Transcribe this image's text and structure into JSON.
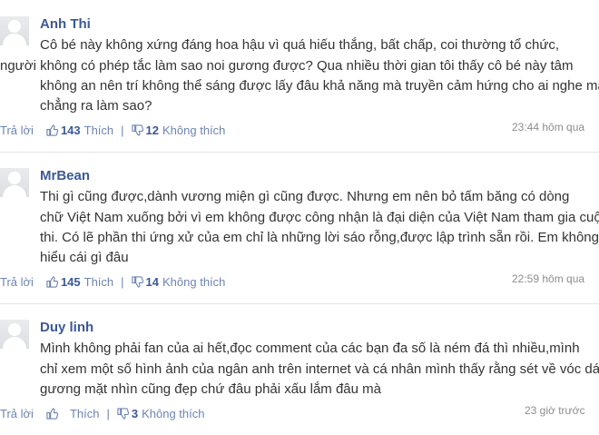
{
  "comments": [
    {
      "author": "Anh Thi",
      "lines": [
        "Cô bé này không xứng đáng hoa hậu vì quá hiếu thắng, bất chấp, coi thường tổ chức,",
        "người không có phép tắc làm sao noi gương được? Qua nhiều thời gian tôi thấy cô bé này tâm",
        "không an nên trí không thể sáng được lấy đâu khả năng mà truyền cảm hứng cho ai nghe mà",
        "chẳng ra làm sao?"
      ],
      "reply_label": "Trả lời",
      "like_count": "143",
      "like_label": "Thích",
      "dislike_count": "12",
      "dislike_label": "Không thích",
      "time": "23:44 hôm qua"
    },
    {
      "author": "MrBean",
      "lines": [
        "Thi gì cũng được,dành vương miện gì cũng được. Nhưng em nên bỏ tấm băng có dòng",
        "chữ Việt Nam xuống bởi vì em không được công nhận là đại diện của Việt Nam tham gia cuộc",
        "thi. Có lẽ phần thi ứng xử của em chỉ là những lời sáo rỗng,được lập trình sẵn rồi. Em không",
        "hiểu cái gì đâu"
      ],
      "reply_label": "Trả lời",
      "like_count": "145",
      "like_label": "Thích",
      "dislike_count": "14",
      "dislike_label": "Không thích",
      "time": "22:59 hôm qua"
    },
    {
      "author": "Duy linh",
      "lines": [
        "Mình không phải fan của ai hết,đọc comment của các bạn đa số là ném đá thì nhiều,mình",
        "chỉ xem một số hình ảnh của ngân anh trên internet và cá nhân mình thấy rằng sét về vóc dáng",
        "gương mặt nhìn cũng đẹp chứ đâu phải xấu lắm đâu mà"
      ],
      "reply_label": "Trả lời",
      "like_count": "",
      "like_label": "Thích",
      "dislike_count": "3",
      "dislike_label": "Không thích",
      "time": "23 giờ trước"
    }
  ],
  "colors": {
    "author": "#3b5998",
    "link": "#6d84b4",
    "text": "#333333",
    "time": "#8d8d8d",
    "divider": "#e5e5e5"
  },
  "icons": {
    "like": "thumbs-up-icon",
    "dislike": "thumbs-down-icon",
    "avatar": "default-avatar-icon"
  }
}
